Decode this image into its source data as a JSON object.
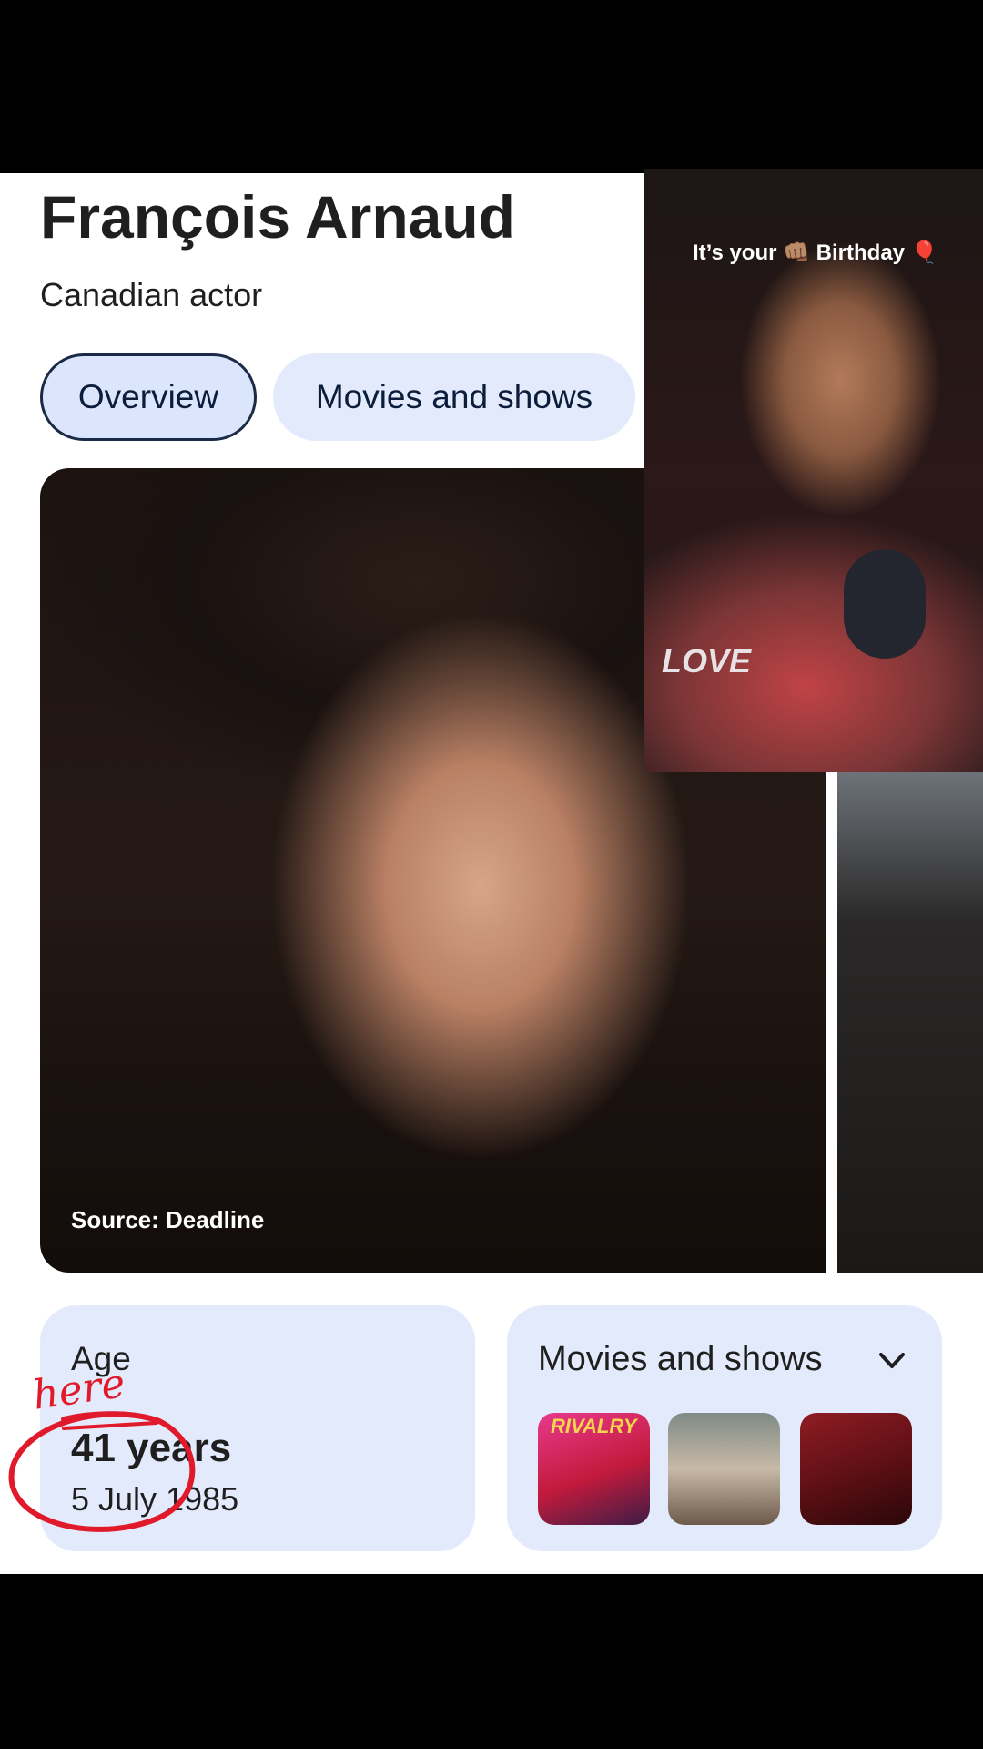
{
  "header": {
    "title": "François Arnaud",
    "subtitle": "Canadian actor"
  },
  "tabs": [
    {
      "label": "Overview",
      "active": true
    },
    {
      "label": "Movies and shows",
      "active": false
    }
  ],
  "main_photo": {
    "source": "Source: Deadline"
  },
  "age_card": {
    "label": "Age",
    "value": "41 years",
    "birth_date": "5 July 1985"
  },
  "movies_card": {
    "label": "Movies and shows",
    "thumbnails": [
      {
        "icon": "movie-poster",
        "text": "RIVALRY"
      },
      {
        "icon": "movie-poster"
      },
      {
        "icon": "movie-poster"
      }
    ]
  },
  "overlay_video": {
    "text": "It’s your 👊🏽 Birthday 🎈",
    "shirt_text": "LOVE"
  },
  "annotation": {
    "text": "here",
    "color": "#e01a2a"
  },
  "colors": {
    "chip_active_bg": "#dbe5fb",
    "card_bg": "#e3eafb"
  }
}
